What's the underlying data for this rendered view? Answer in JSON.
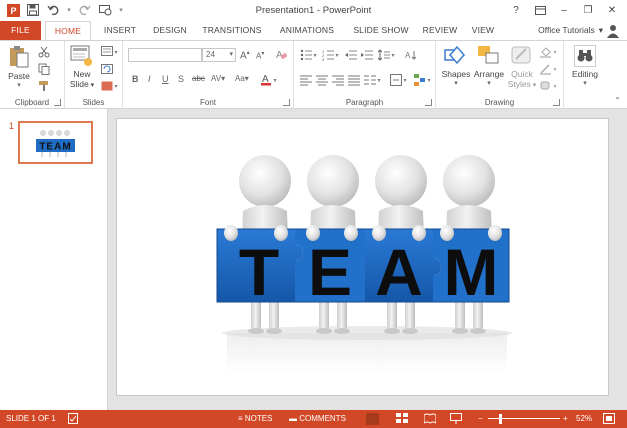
{
  "window": {
    "title": "Presentation1 - PowerPoint",
    "help_label": "?",
    "controls": {
      "minimize": "–",
      "restore": "❐",
      "close": "✕"
    }
  },
  "tabs": [
    "FILE",
    "HOME",
    "INSERT",
    "DESIGN",
    "TRANSITIONS",
    "ANIMATIONS",
    "SLIDE SHOW",
    "REVIEW",
    "VIEW"
  ],
  "account": {
    "name": "Office Tutorials",
    "arrow": "▾"
  },
  "ribbon": {
    "clipboard": {
      "label": "Clipboard",
      "paste": "Paste"
    },
    "slides": {
      "label": "Slides",
      "new_slide_line1": "New",
      "new_slide_line2": "Slide"
    },
    "font": {
      "label": "Font",
      "font_name": "",
      "font_size": "24"
    },
    "paragraph": {
      "label": "Paragraph"
    },
    "drawing": {
      "label": "Drawing",
      "shapes": "Shapes",
      "arrange": "Arrange",
      "quick_styles_line1": "Quick",
      "quick_styles_line2": "Styles"
    },
    "editing": {
      "label": "Editing"
    }
  },
  "slides_pane": {
    "number": "1"
  },
  "slide": {
    "banner_letters": [
      "T",
      "E",
      "A",
      "M"
    ],
    "thumb_text": "TEAM"
  },
  "status": {
    "slide_counter": "SLIDE 1 OF 1",
    "notes": "NOTES",
    "comments": "COMMENTS",
    "zoom_minus": "−",
    "zoom_plus": "+",
    "zoom": "52%"
  },
  "colors": {
    "accent": "#d24726",
    "banner": "#1f6cc4",
    "figure": "#e7e7e7"
  }
}
